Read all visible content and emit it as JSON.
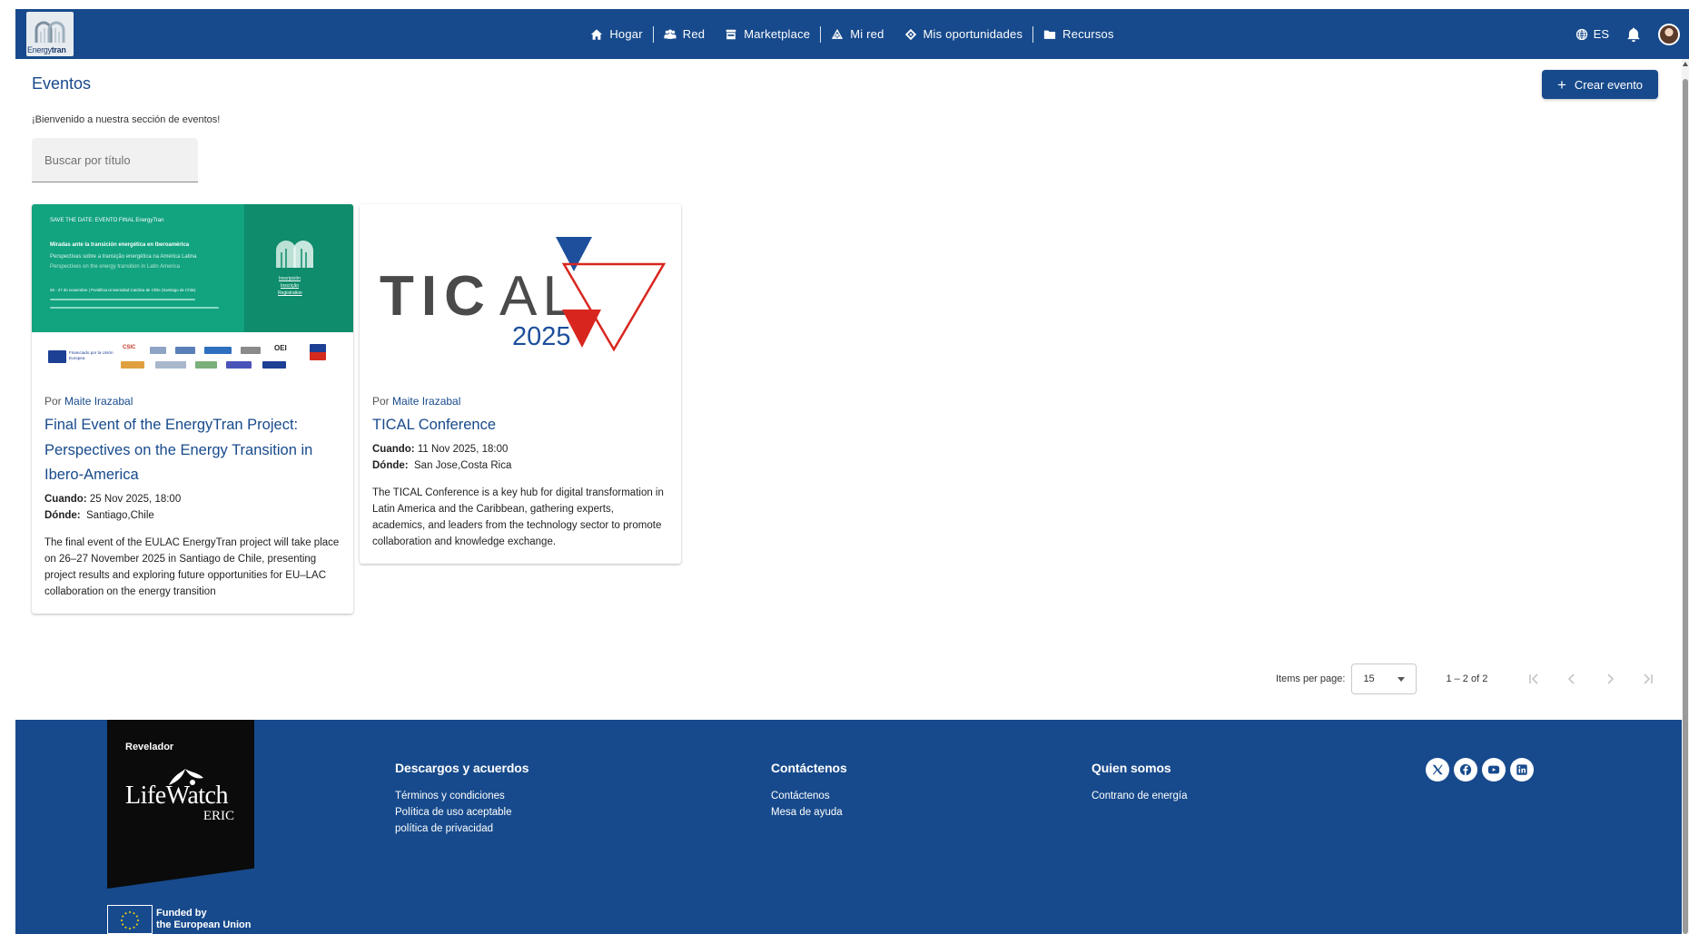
{
  "navbar": {
    "logo_text_light": "Energy",
    "logo_text_bold": "tran",
    "items": [
      {
        "icon": "home-icon",
        "label": "Hogar"
      },
      {
        "icon": "people-icon",
        "label": "Red"
      },
      {
        "icon": "storefront-icon",
        "label": "Marketplace"
      },
      {
        "icon": "network-icon",
        "label": "Mi red"
      },
      {
        "icon": "tag-icon",
        "label": "Mis oportunidades"
      },
      {
        "icon": "folder-icon",
        "label": "Recursos"
      }
    ],
    "language": "ES"
  },
  "page": {
    "title": "Eventos",
    "create_button": "Crear evento",
    "welcome": "¡Bienvenido a nuestra sección de eventos!",
    "search_placeholder": "Buscar por título"
  },
  "events": [
    {
      "by_prefix": "Por",
      "author": "Maite Irazabal",
      "title": "Final Event of the EnergyTran Project: Perspectives on the Energy Transition in Ibero-America",
      "when_label": "Cuando:",
      "when": "25 Nov 2025, 18:00",
      "where_label": "Dónde:",
      "where": "Santiago,Chile",
      "description": "The final event of the EULAC EnergyTran project will take place on 26–27 November 2025 in Santiago de Chile, presenting project results and exploring future opportunities for EU–LAC collaboration on the energy transition",
      "poster": {
        "save_the_date": "SAVE THE DATE: EVENTO FINAL EnergyTran",
        "headline": "Miradas ante la transición energética en Iberoamérica",
        "subline_pt": "Perspectivas sobre a transição energética na América Latina",
        "subline_en": "Perspectives on the energy transition in Latin America",
        "dates": "26 - 27 de noviembre | Pontificia Universidad Católica de Chile (Santiago de Chile)",
        "register_es": "Inscripción",
        "register_pt": "Inscrição",
        "register_en": "Registration",
        "eu_funded": "Financiado por la Unión Europea",
        "partner_oei": "OEI",
        "partner_csic": "CSIC"
      }
    },
    {
      "by_prefix": "Por",
      "author": "Maite Irazabal",
      "title": "TICAL Conference",
      "when_label": "Cuando:",
      "when": "11 Nov 2025, 18:00",
      "where_label": "Dónde:",
      "where": "San Jose,Costa Rica",
      "description": "The TICAL Conference is a key hub for digital transformation in Latin America and the Caribbean, gathering experts, academics, and leaders from the technology sector to promote collaboration and knowledge exchange.",
      "logo": {
        "word": "TICAL",
        "word_part1": "TIC",
        "word_part2": "AL",
        "year": "2025"
      }
    }
  ],
  "paginator": {
    "items_per_page_label": "Items per page:",
    "page_size": "15",
    "range": "1 – 2 of 2"
  },
  "footer": {
    "banner_label": "Revelador",
    "lifewatch": "LifeWatch",
    "lifewatch_sub": "ERIC",
    "eu_funded_line1": "Funded by",
    "eu_funded_line2": "the European Union",
    "columns": [
      {
        "title": "Descargos y acuerdos",
        "links": [
          "Términos y condiciones",
          "Política de uso aceptable",
          "política de privacidad"
        ]
      },
      {
        "title": "Contáctenos",
        "links": [
          "Contáctenos",
          "Mesa de ayuda"
        ]
      },
      {
        "title": "Quien somos",
        "links": [
          "Contrano de energía"
        ]
      }
    ],
    "socials": [
      "x-icon",
      "facebook-icon",
      "youtube-icon",
      "linkedin-icon"
    ]
  },
  "colors": {
    "brand_blue": "#174a8c",
    "poster_green": "#12a37f",
    "tical_blue": "#1d4f9c",
    "tical_red": "#d8261f",
    "link_blue": "#174a8c"
  }
}
